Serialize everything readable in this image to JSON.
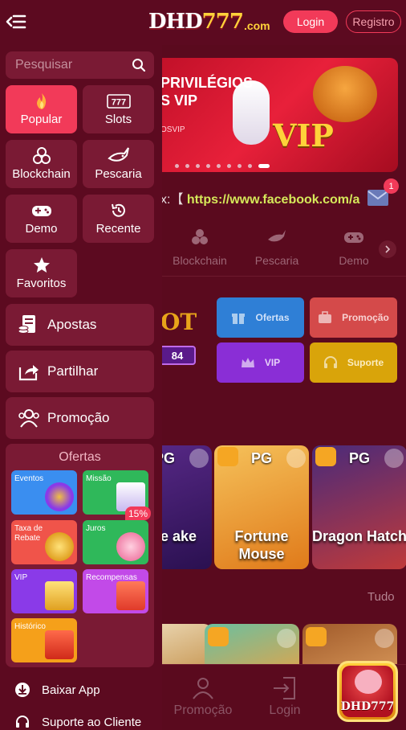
{
  "header": {
    "logo_main": "DHD",
    "logo_num": "777",
    "logo_suffix": ".com",
    "login_label": "Login",
    "register_label": "Registro"
  },
  "drawer": {
    "search_placeholder": "Pesquisar",
    "categories": [
      {
        "label": "Popular",
        "icon": "flame-icon",
        "active": true
      },
      {
        "label": "Slots",
        "icon": "slots-777-icon"
      },
      {
        "label": "Blockchain",
        "icon": "blockchain-icon"
      },
      {
        "label": "Pescaria",
        "icon": "shark-icon"
      },
      {
        "label": "Demo",
        "icon": "gamepad-icon"
      },
      {
        "label": "Recente",
        "icon": "history-icon"
      },
      {
        "label": "Favoritos",
        "icon": "star-icon"
      }
    ],
    "rows": [
      {
        "label": "Apostas",
        "icon": "bets-icon"
      },
      {
        "label": "Partilhar",
        "icon": "share-icon"
      },
      {
        "label": "Promoção",
        "icon": "users-icon"
      }
    ],
    "offers": {
      "title": "Ofertas",
      "items": [
        {
          "label": "Eventos",
          "color": "#3a8ef0"
        },
        {
          "label": "Missão",
          "color": "#2fb85a"
        },
        {
          "label": "Taxa de Rebate",
          "color": "#f0544a"
        },
        {
          "label": "Juros",
          "color": "#2fb85a"
        },
        {
          "label": "VIP",
          "color": "#8a3ae8"
        },
        {
          "label": "Recompensas",
          "color": "#c24ae8"
        },
        {
          "label": "Histórico",
          "color": "#f5a01a"
        }
      ],
      "juros_badge": "15%"
    },
    "links": [
      {
        "label": "Baixar App",
        "icon": "download-icon"
      },
      {
        "label": "Suporte ao Cliente",
        "icon": "headset-icon"
      }
    ]
  },
  "main": {
    "banner": {
      "title": "PRIVILÉGIOS S VIP",
      "tag": "OSVIP",
      "vip_text": "VIP"
    },
    "marquee": {
      "prefix": "x:【",
      "url": "https://www.facebook.com/a"
    },
    "mail_badge": "1",
    "categories": [
      {
        "label": "Blockchain",
        "icon": "blockchain-icon"
      },
      {
        "label": "Pescaria",
        "icon": "shark-icon"
      },
      {
        "label": "Demo",
        "icon": "gamepad-icon"
      }
    ],
    "jackpot": {
      "text": "OT",
      "number": "84"
    },
    "promo_buttons": [
      {
        "label": "Ofertas",
        "color": "#2f7fd6",
        "icon": "gift-icon"
      },
      {
        "label": "Promoção",
        "color": "#d44a4a",
        "icon": "briefcase-icon"
      },
      {
        "label": "VIP",
        "color": "#8a2ed6",
        "icon": "crown-icon"
      },
      {
        "label": "Suporte",
        "color": "#d9a40a",
        "icon": "headset-icon"
      }
    ],
    "games": [
      {
        "provider": "PG",
        "name": "rtune ake"
      },
      {
        "provider": "PG",
        "name": "Fortune Mouse"
      },
      {
        "provider": "PG",
        "name": "Dragon Hatch"
      }
    ],
    "see_all": "Tudo",
    "bottom_nav": [
      {
        "label": "Promoção",
        "icon": "users-icon"
      },
      {
        "label": "Login",
        "icon": "login-icon"
      }
    ],
    "app_badge": "DHD777"
  }
}
